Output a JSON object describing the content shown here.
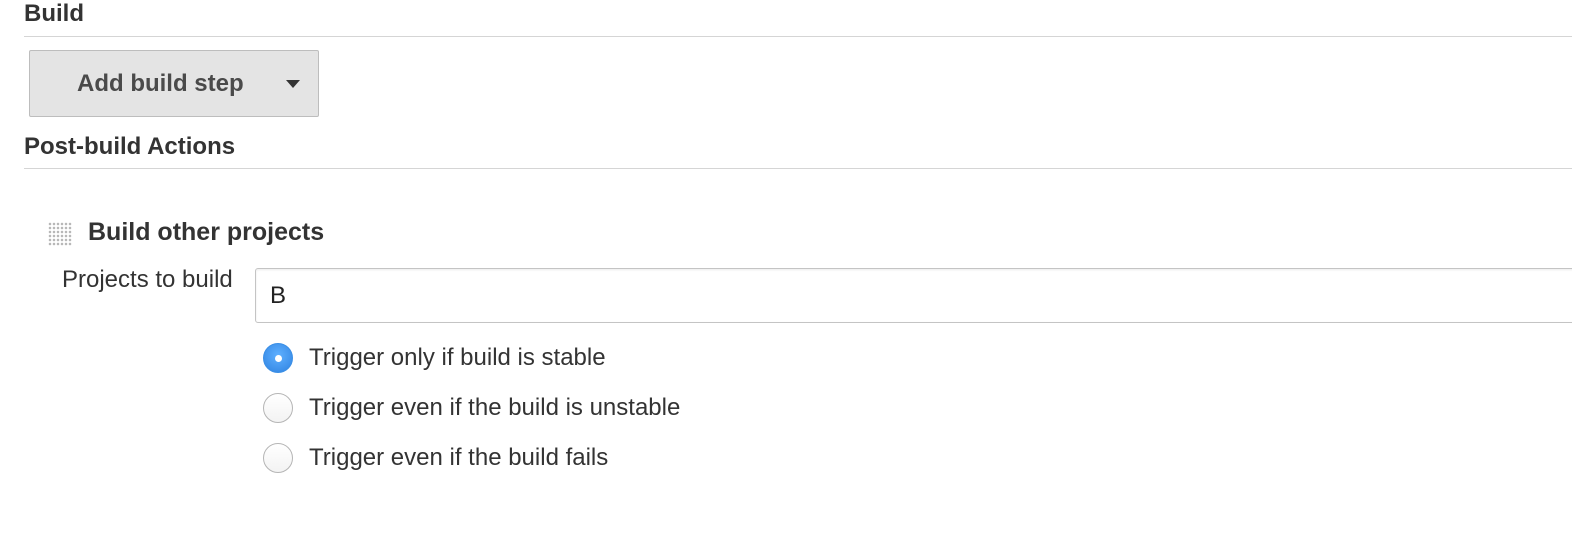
{
  "build_section": {
    "title": "Build",
    "add_step_button": {
      "label": "Add build step",
      "icon": "caret-down-icon"
    }
  },
  "post_build_section": {
    "title": "Post-build Actions",
    "action": {
      "title": "Build other projects",
      "drag_icon": "drag-handle-icon",
      "projects_field": {
        "label": "Projects to build",
        "value": "B"
      },
      "trigger_options": [
        {
          "label": "Trigger only if build is stable",
          "checked": true
        },
        {
          "label": "Trigger even if the build is unstable",
          "checked": false
        },
        {
          "label": "Trigger even if the build fails",
          "checked": false
        }
      ]
    }
  },
  "colors": {
    "radio_selected": "#3d90ea",
    "button_bg": "#e4e4e4",
    "divider": "#d5d5d5"
  }
}
